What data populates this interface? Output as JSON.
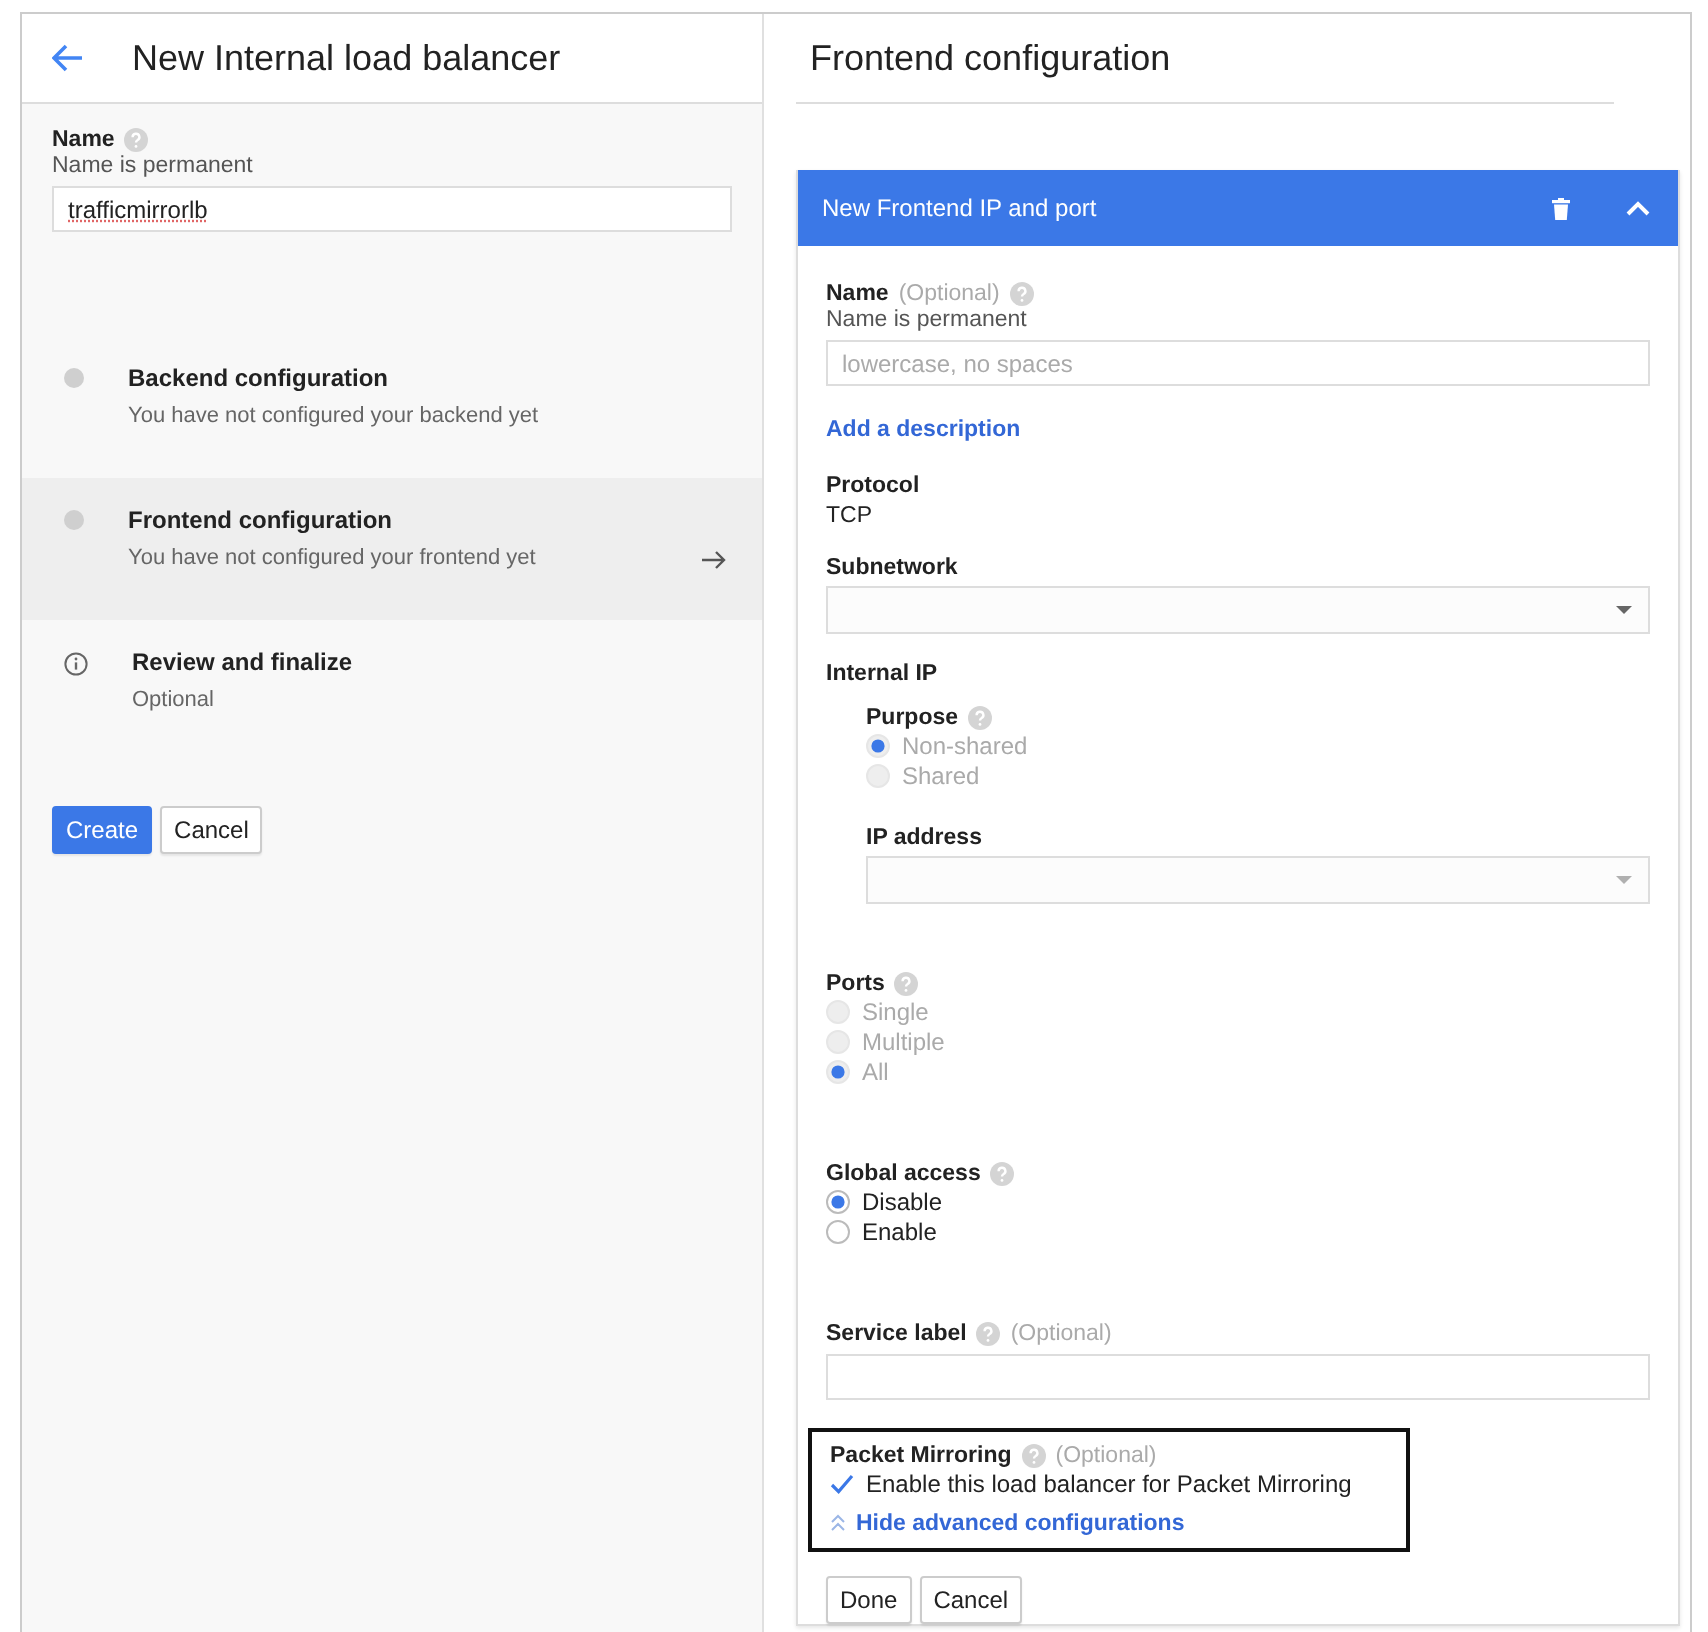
{
  "header": {
    "title": "New Internal load balancer"
  },
  "name_field": {
    "label": "Name",
    "help": true,
    "hint": "Name is permanent",
    "value": "trafficmirrorlb"
  },
  "steps": [
    {
      "kind": "pending",
      "title": "Backend configuration",
      "subtitle": "You have not configured your backend yet",
      "selected": false
    },
    {
      "kind": "pending",
      "title": "Frontend configuration",
      "subtitle": "You have not configured your frontend yet",
      "selected": true
    },
    {
      "kind": "info",
      "title": "Review and finalize",
      "subtitle": "Optional",
      "selected": false
    }
  ],
  "buttons": [
    {
      "label": "Create",
      "primary": true
    },
    {
      "label": "Cancel",
      "primary": false
    }
  ],
  "panel": {
    "title": "Frontend configuration"
  },
  "card": {
    "title": "New Frontend IP and port",
    "expanded": true,
    "fields": [
      {
        "kind": "input",
        "label": "Name",
        "annotations": [
          {
            "kind": "note",
            "text": "(Optional)"
          },
          {
            "kind": "help"
          }
        ],
        "hint": "Name is permanent",
        "placeholder": "lowercase, no spaces"
      },
      {
        "kind": "link",
        "text": "Add a description"
      },
      {
        "kind": "static",
        "label": "Protocol",
        "value": "TCP"
      },
      {
        "kind": "select",
        "label": "Subnetwork",
        "disabled": false
      },
      {
        "kind": "group",
        "label": "Internal IP",
        "children": [
          {
            "kind": "radio",
            "label": "Purpose",
            "annotations": [
              {
                "kind": "help"
              }
            ],
            "disabled": true,
            "options": [
              {
                "label": "Non-shared",
                "selected": true
              },
              {
                "label": "Shared",
                "selected": false
              }
            ]
          },
          {
            "kind": "select",
            "label": "IP address",
            "disabled": true
          }
        ]
      },
      {
        "kind": "radio",
        "label": "Ports",
        "annotations": [
          {
            "kind": "help"
          }
        ],
        "disabled": true,
        "options": [
          {
            "label": "Single",
            "selected": false
          },
          {
            "label": "Multiple",
            "selected": false
          },
          {
            "label": "All",
            "selected": true
          }
        ]
      },
      {
        "kind": "radio",
        "label": "Global access",
        "annotations": [
          {
            "kind": "help"
          }
        ],
        "disabled": false,
        "options": [
          {
            "label": "Disable",
            "selected": true
          },
          {
            "label": "Enable",
            "selected": false
          }
        ]
      },
      {
        "kind": "input",
        "label": "Service label",
        "annotations": [
          {
            "kind": "help"
          },
          {
            "kind": "note",
            "text": "(Optional)"
          }
        ]
      },
      {
        "kind": "box",
        "outlined": true,
        "children": [
          {
            "kind": "checkbox",
            "label": "Packet Mirroring",
            "annotations": [
              {
                "kind": "help"
              },
              {
                "kind": "note",
                "text": "(Optional)"
              }
            ],
            "options": [
              {
                "label": "Enable this load balancer for Packet Mirroring",
                "checked": true
              }
            ]
          },
          {
            "kind": "toggle",
            "text": "Hide advanced configurations",
            "expanded": true
          }
        ]
      }
    ],
    "buttons": [
      {
        "label": "Done",
        "primary": false
      },
      {
        "label": "Cancel",
        "primary": false
      }
    ]
  }
}
